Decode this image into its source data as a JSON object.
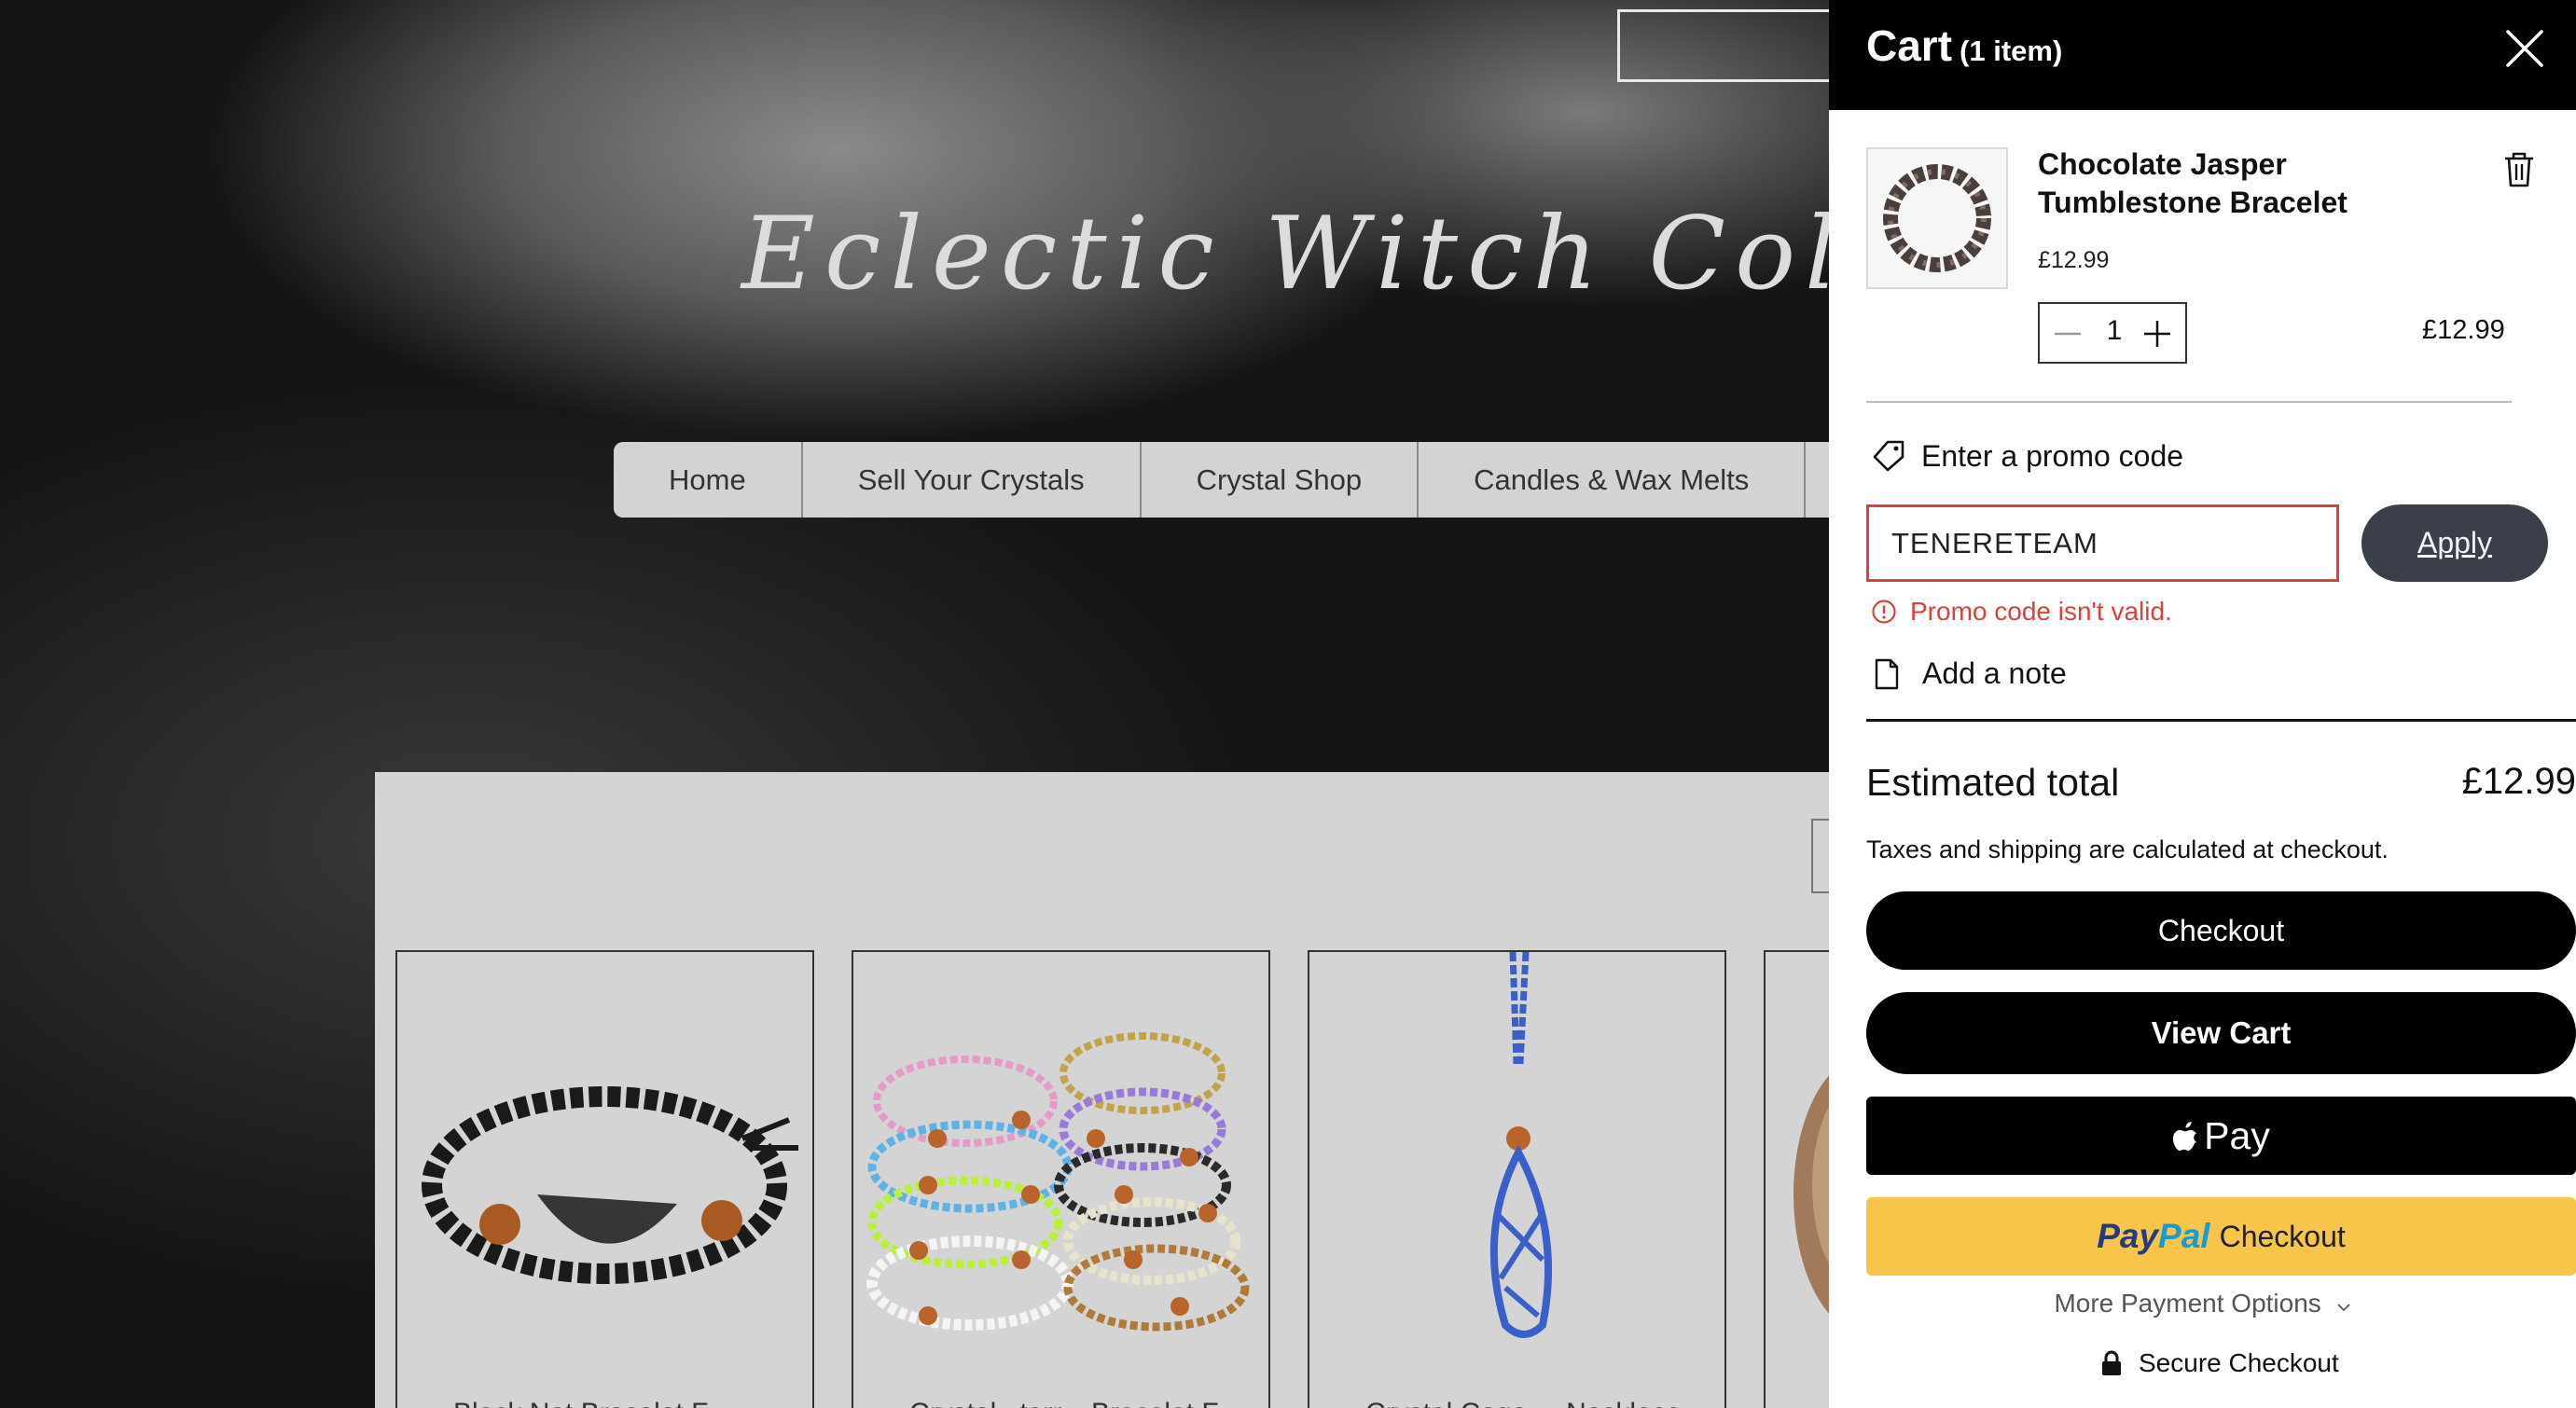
{
  "site": {
    "title": "Eclectic Witch Collection",
    "nav": [
      "Home",
      "Sell Your Crystals",
      "Crystal Shop",
      "Candles & Wax Melts"
    ],
    "products": [
      {
        "title": "Black Net Bracelet F..."
      },
      {
        "title": "Crystal...terr... Bracelet F..."
      },
      {
        "title": "Crystal Cage ... Necklace"
      },
      {
        "title": ""
      }
    ]
  },
  "cart": {
    "title": "Cart",
    "count_label": "(1 item)",
    "item": {
      "name": "Chocolate Jasper Tumblestone Bracelet",
      "unit_price": "£12.99",
      "quantity": "1",
      "line_total": "£12.99"
    },
    "promo": {
      "toggle_label": "Enter a promo code",
      "input_value": "TENERETEAM",
      "apply_label": "Apply",
      "error": "Promo code isn't valid."
    },
    "note_label": "Add a note",
    "estimated_label": "Estimated total",
    "estimated_value": "£12.99",
    "tax_note": "Taxes and shipping are calculated at checkout.",
    "checkout_label": "Checkout",
    "view_cart_label": "View Cart",
    "apple_pay_label": "Pay",
    "paypal": {
      "brand_a": "Pay",
      "brand_b": "Pal",
      "label": "Checkout"
    },
    "more_payment_label": "More Payment Options",
    "secure_label": "Secure Checkout"
  },
  "colors": {
    "error": "#d9423c",
    "apply_button": "#3b3f49",
    "paypal_button": "#f7c549",
    "header": "#000000"
  }
}
